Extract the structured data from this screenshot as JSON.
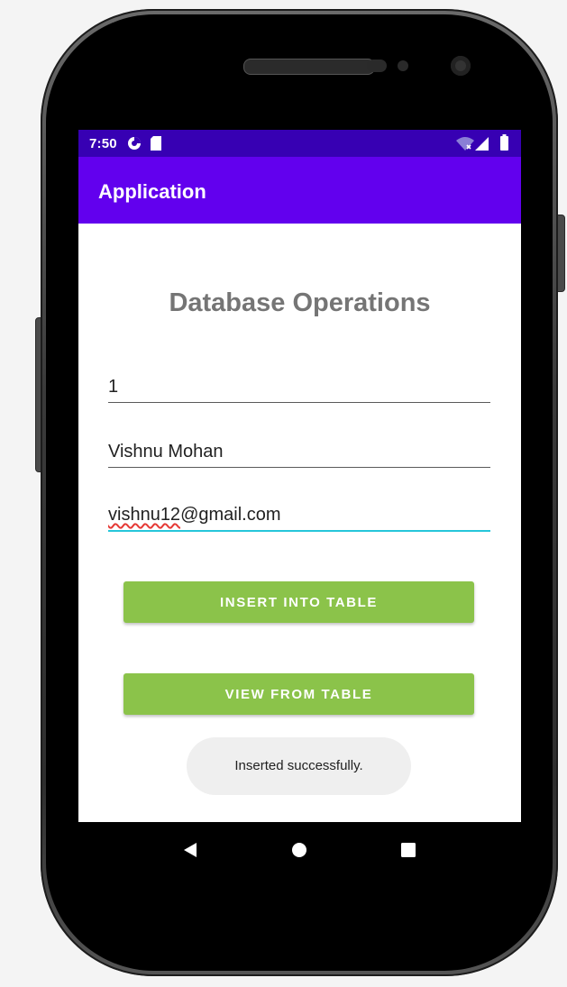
{
  "status_bar": {
    "time": "7:50",
    "icons": [
      "data-saver-icon",
      "sd-card-icon",
      "wifi-icon",
      "signal-icon",
      "battery-icon"
    ]
  },
  "app_bar": {
    "title": "Application"
  },
  "main": {
    "heading": "Database Operations",
    "fields": {
      "id_value": "1",
      "name_value": "Vishnu Mohan",
      "email_misspelled_part": "vishnu12",
      "email_rest": "@gmail.com"
    },
    "buttons": {
      "insert_label": "INSERT INTO TABLE",
      "view_label": "VIEW FROM TABLE"
    },
    "toast": "Inserted successfully."
  },
  "nav_bar": {
    "icons": [
      "back-icon",
      "home-icon",
      "recents-icon"
    ]
  },
  "colors": {
    "status_bar": "#3700b3",
    "app_bar": "#6200ee",
    "button": "#8bc34a",
    "focus_underline": "#26c6da",
    "heading_text": "#757575"
  }
}
